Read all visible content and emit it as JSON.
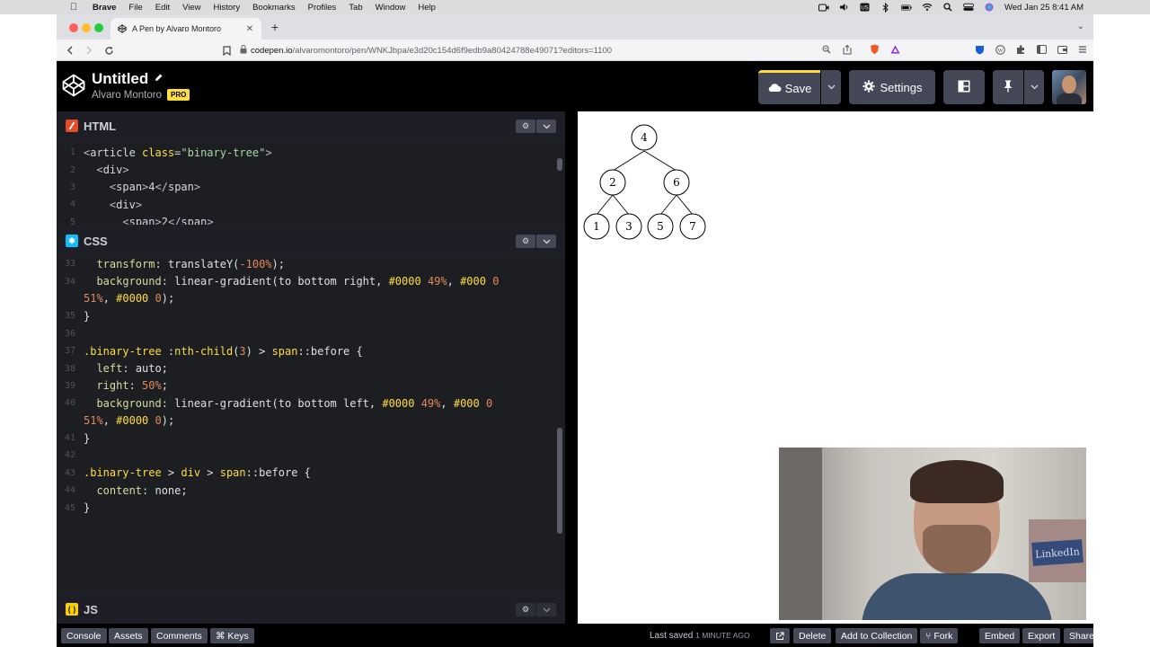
{
  "menubar": {
    "app": "Brave",
    "items": [
      "File",
      "Edit",
      "View",
      "History",
      "Bookmarks",
      "Profiles",
      "Tab",
      "Window",
      "Help"
    ],
    "clock": "Wed Jan 25  8:41 AM"
  },
  "browser": {
    "tab_title": "A Pen by Alvaro Montoro",
    "url_host": "codepen.io",
    "url_path": "/alvaromontoro/pen/WNKJbpa/e3d20c154d6f9edb9a80424788e49071?editors=1100"
  },
  "header": {
    "pen_title": "Untitled",
    "author": "Alvaro Montoro",
    "pro_badge": "PRO",
    "save_label": "Save",
    "settings_label": "Settings"
  },
  "html_panel": {
    "label": "HTML",
    "lines": [
      {
        "n": "1",
        "segs": [
          [
            "t-tag",
            "<"
          ],
          [
            "t-name",
            "article "
          ],
          [
            "t-attr",
            "class"
          ],
          [
            "t-pun",
            "="
          ],
          [
            "t-str",
            "\"binary-tree\""
          ],
          [
            "t-tag",
            ">"
          ]
        ]
      },
      {
        "n": "2",
        "segs": [
          [
            "t-kw",
            "  "
          ],
          [
            "t-tag",
            "<"
          ],
          [
            "t-name",
            "div"
          ],
          [
            "t-tag",
            ">"
          ]
        ]
      },
      {
        "n": "3",
        "segs": [
          [
            "t-kw",
            "    "
          ],
          [
            "t-tag",
            "<"
          ],
          [
            "t-name",
            "span"
          ],
          [
            "t-tag",
            ">"
          ],
          [
            "txt",
            "4"
          ],
          [
            "t-tag",
            "</"
          ],
          [
            "t-name",
            "span"
          ],
          [
            "t-tag",
            ">"
          ]
        ]
      },
      {
        "n": "4",
        "segs": [
          [
            "t-kw",
            "    "
          ],
          [
            "t-tag",
            "<"
          ],
          [
            "t-name",
            "div"
          ],
          [
            "t-tag",
            ">"
          ]
        ]
      },
      {
        "n": "5",
        "segs": [
          [
            "t-kw",
            "      "
          ],
          [
            "t-tag",
            "<"
          ],
          [
            "t-name",
            "span"
          ],
          [
            "t-tag",
            ">"
          ],
          [
            "txt",
            "2"
          ],
          [
            "t-tag",
            "</"
          ],
          [
            "t-name",
            "span"
          ],
          [
            "t-tag",
            ">"
          ]
        ]
      }
    ]
  },
  "css_panel": {
    "label": "CSS",
    "lines": [
      {
        "n": "33",
        "segs": [
          [
            "t-kw",
            "  "
          ],
          [
            "t-prop",
            "transform"
          ],
          [
            "t-pun",
            ": "
          ],
          [
            "t-kw",
            "translateY("
          ],
          [
            "t-num",
            "-100%"
          ],
          [
            "t-kw",
            ");"
          ]
        ]
      },
      {
        "n": "34",
        "segs": [
          [
            "t-kw",
            "  "
          ],
          [
            "t-prop",
            "background"
          ],
          [
            "t-pun",
            ": "
          ],
          [
            "t-kw",
            "linear-gradient(to bottom right, "
          ],
          [
            "t-sel",
            "#0000"
          ],
          [
            "t-kw",
            " "
          ],
          [
            "t-num",
            "49%"
          ],
          [
            "t-kw",
            ", "
          ],
          [
            "t-sel",
            "#000"
          ],
          [
            "t-kw",
            " "
          ],
          [
            "t-num",
            "0"
          ]
        ]
      },
      {
        "n": "",
        "segs": [
          [
            "t-num",
            "51%"
          ],
          [
            "t-kw",
            ", "
          ],
          [
            "t-sel",
            "#0000"
          ],
          [
            "t-kw",
            " "
          ],
          [
            "t-num",
            "0"
          ],
          [
            "t-kw",
            ");"
          ]
        ]
      },
      {
        "n": "35",
        "segs": [
          [
            "t-kw",
            "}"
          ]
        ]
      },
      {
        "n": "36",
        "segs": []
      },
      {
        "n": "37",
        "segs": [
          [
            "t-sel",
            ".binary-tree "
          ],
          [
            "t-kw",
            ":"
          ],
          [
            "t-sel",
            "nth-child"
          ],
          [
            "t-kw",
            "("
          ],
          [
            "t-num",
            "3"
          ],
          [
            "t-kw",
            ") > "
          ],
          [
            "t-sel",
            "span"
          ],
          [
            "t-kw",
            "::before {"
          ]
        ]
      },
      {
        "n": "38",
        "segs": [
          [
            "t-kw",
            "  "
          ],
          [
            "t-prop",
            "left"
          ],
          [
            "t-pun",
            ": "
          ],
          [
            "t-kw",
            "auto;"
          ]
        ]
      },
      {
        "n": "39",
        "segs": [
          [
            "t-kw",
            "  "
          ],
          [
            "t-prop",
            "right"
          ],
          [
            "t-pun",
            ": "
          ],
          [
            "t-num",
            "50%"
          ],
          [
            "t-kw",
            ";"
          ]
        ]
      },
      {
        "n": "40",
        "segs": [
          [
            "t-kw",
            "  "
          ],
          [
            "t-prop",
            "background"
          ],
          [
            "t-pun",
            ": "
          ],
          [
            "t-kw",
            "linear-gradient(to bottom left, "
          ],
          [
            "t-sel",
            "#0000"
          ],
          [
            "t-kw",
            " "
          ],
          [
            "t-num",
            "49%"
          ],
          [
            "t-kw",
            ", "
          ],
          [
            "t-sel",
            "#000"
          ],
          [
            "t-kw",
            " "
          ],
          [
            "t-num",
            "0"
          ]
        ]
      },
      {
        "n": "",
        "segs": [
          [
            "t-num",
            "51%"
          ],
          [
            "t-kw",
            ", "
          ],
          [
            "t-sel",
            "#0000"
          ],
          [
            "t-kw",
            " "
          ],
          [
            "t-num",
            "0"
          ],
          [
            "t-kw",
            ");"
          ]
        ]
      },
      {
        "n": "41",
        "segs": [
          [
            "t-kw",
            "}"
          ]
        ]
      },
      {
        "n": "42",
        "segs": []
      },
      {
        "n": "43",
        "segs": [
          [
            "t-sel",
            ".binary-tree "
          ],
          [
            "t-kw",
            "> "
          ],
          [
            "t-sel",
            "div "
          ],
          [
            "t-kw",
            "> "
          ],
          [
            "t-sel",
            "span"
          ],
          [
            "t-kw",
            "::before {"
          ]
        ]
      },
      {
        "n": "44",
        "segs": [
          [
            "t-kw",
            "  "
          ],
          [
            "t-prop",
            "content"
          ],
          [
            "t-pun",
            ": "
          ],
          [
            "t-kw",
            "none;"
          ]
        ]
      },
      {
        "n": "45",
        "segs": [
          [
            "t-kw",
            "}"
          ]
        ]
      }
    ]
  },
  "js_panel": {
    "label": "JS"
  },
  "preview": {
    "tree_nodes": [
      "4",
      "2",
      "6",
      "1",
      "3",
      "5",
      "7"
    ],
    "webcam_sign": "LinkedIn"
  },
  "footer": {
    "console": "Console",
    "assets": "Assets",
    "comments": "Comments",
    "keys": "⌘ Keys",
    "last_saved": "Last saved",
    "saved_ago": "1 MINUTE AGO",
    "delete": "Delete",
    "add_to_collection": "Add to Collection",
    "fork": "Fork",
    "embed": "Embed",
    "export": "Export",
    "share": "Share"
  },
  "colors": {
    "accent_yellow": "#ffdd40",
    "editor_bg": "#1d1e22",
    "button_bg": "#444857"
  },
  "icons": [
    "apple-icon",
    "camera-icon",
    "volume-icon",
    "bluetooth-icon",
    "battery-icon",
    "wifi-icon",
    "search-icon",
    "control-center-icon",
    "siri-icon",
    "codepen-logo",
    "pencil-icon",
    "cloud-icon",
    "gear-icon",
    "layout-icon",
    "pin-icon",
    "chevron-down-icon",
    "external-link-icon"
  ]
}
